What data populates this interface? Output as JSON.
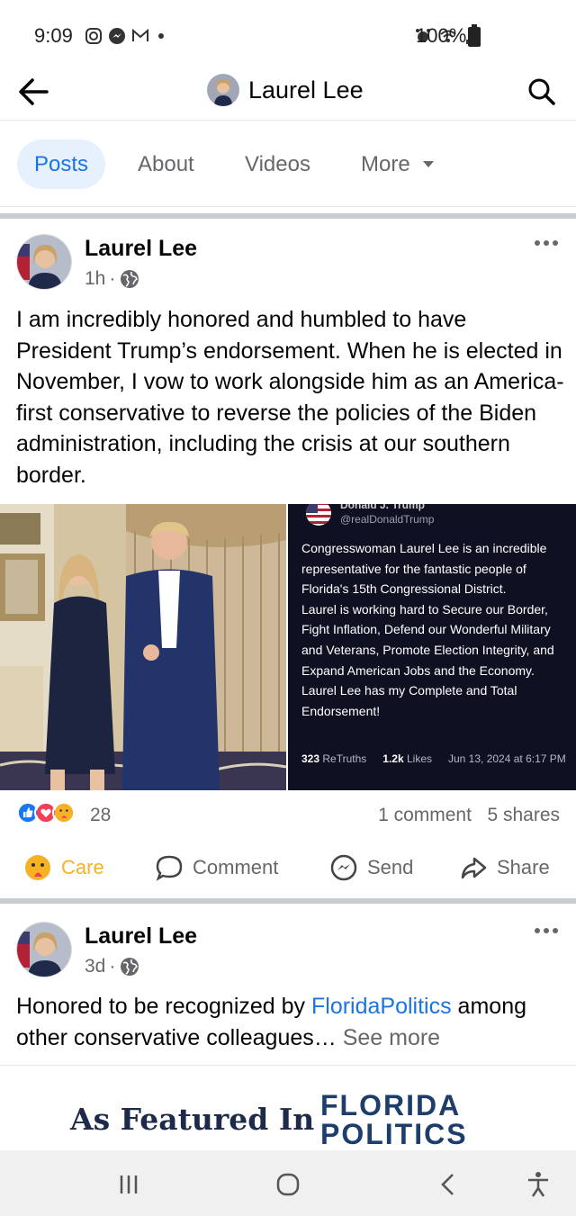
{
  "status_bar": {
    "time": "9:09",
    "battery": "100%"
  },
  "header": {
    "title": "Laurel Lee"
  },
  "tabs": [
    {
      "label": "Posts"
    },
    {
      "label": "About"
    },
    {
      "label": "Videos"
    },
    {
      "label": "More"
    }
  ],
  "posts": [
    {
      "author": "Laurel Lee",
      "time": "1h",
      "text": "I am incredibly honored and humbled to have President Trump’s endorsement. When he is elected in November, I vow to work alongside him as an America-first conservative to reverse the policies of the Biden administration, including the crisis at our southern border.",
      "embed": {
        "name": "Donald J. Trump",
        "handle": "@realDonaldTrump",
        "body": "Congresswoman Laurel Lee is an incredible representative for the fantastic people of Florida's 15th Congressional District.\nLaurel is working hard to Secure our Border, Fight Inflation, Defend our Wonderful Military and Veterans, Promote Election Integrity, and Expand American Jobs and the Economy.  Laurel Lee has my Complete and Total Endorsement!",
        "retruths_count": "323",
        "retruths_label": "ReTruths",
        "likes_count": "1.2k",
        "likes_label": "Likes",
        "date": "Jun 13, 2024 at 6:17 PM"
      },
      "reaction_count": "28",
      "comments": "1 comment",
      "shares": "5 shares"
    },
    {
      "author": "Laurel Lee",
      "time": "3d",
      "text_before": "Honored to be recognized by ",
      "link": "FloridaPolitics",
      "text_after": " among other conservative colleagues…",
      "see_more": "See more",
      "featured_text": "As Featured In",
      "logo_line1": "FLORIDA",
      "logo_line2": "POLITICS"
    }
  ],
  "actions": {
    "care": "Care",
    "comment": "Comment",
    "send": "Send",
    "share": "Share"
  },
  "colors": {
    "accent": "#1b74e4",
    "care": "#f7b125",
    "muted": "#65676b"
  }
}
